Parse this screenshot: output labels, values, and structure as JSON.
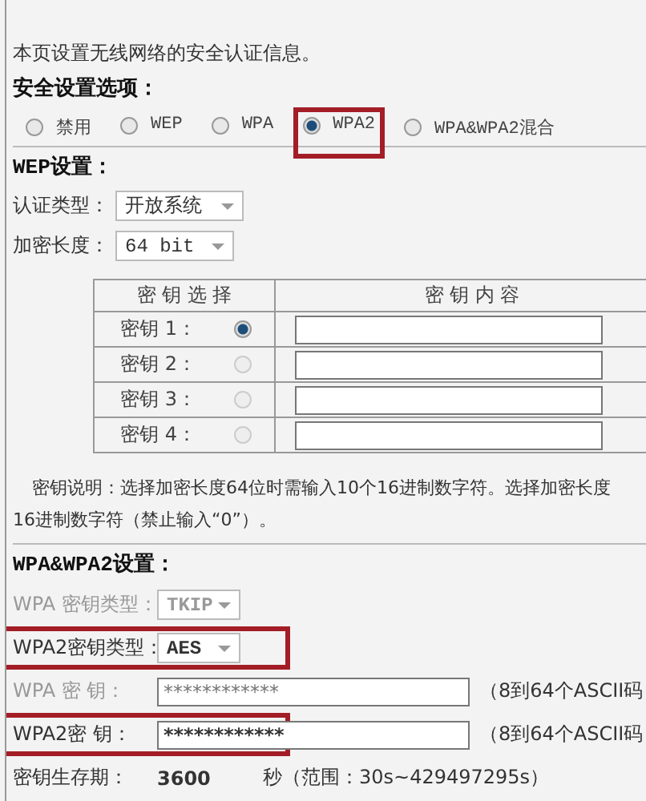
{
  "intro": "本页设置无线网络的安全认证信息。",
  "security": {
    "heading": "安全设置选项：",
    "options": [
      {
        "label": "禁用",
        "selected": false,
        "highlighted": false
      },
      {
        "label": "WEP",
        "selected": false,
        "highlighted": false
      },
      {
        "label": "WPA",
        "selected": false,
        "highlighted": false
      },
      {
        "label": "WPA2",
        "selected": true,
        "highlighted": true
      },
      {
        "label": "WPA&WPA2混合",
        "selected": false,
        "highlighted": false
      }
    ]
  },
  "wep": {
    "heading": "WEP设置：",
    "fields": [
      {
        "label": "认证类型：",
        "value": "开放系统"
      },
      {
        "label": "加密长度：",
        "value": "64 bit"
      }
    ],
    "table": {
      "columns": [
        "密 钥 选 择",
        "密 钥 内 容"
      ],
      "rows": [
        {
          "label": "密钥 1：",
          "selected": true
        },
        {
          "label": "密钥 2：",
          "selected": false
        },
        {
          "label": "密钥 3：",
          "selected": false
        },
        {
          "label": "密钥 4：",
          "selected": false
        }
      ]
    },
    "note_lines": [
      "密钥说明：选择加密长度64位时需输入10个16进制数字符。选择加密长度",
      "16进制数字符（禁止输入“0”）。"
    ]
  },
  "wpa": {
    "heading": "WPA&WPA2设置：",
    "rows": [
      {
        "kind": "select",
        "label": "WPA 密钥类型：",
        "value": "TKIP",
        "disabled": true,
        "highlighted": false
      },
      {
        "kind": "select",
        "label": "WPA2密钥类型：",
        "value": "AES",
        "disabled": false,
        "highlighted": true
      },
      {
        "kind": "password",
        "label": "WPA 密  钥：",
        "value": "************",
        "hint": "（8到64个ASCII码",
        "disabled": true,
        "highlighted": false
      },
      {
        "kind": "password",
        "label": "WPA2密  钥：",
        "value": "************",
        "hint": "（8到64个ASCII码",
        "disabled": false,
        "highlighted": true
      },
      {
        "kind": "text",
        "label": "密钥生存期：",
        "value": "3600",
        "hint": "秒（范围：30s~429497295s）",
        "disabled": false,
        "highlighted": false
      }
    ]
  }
}
